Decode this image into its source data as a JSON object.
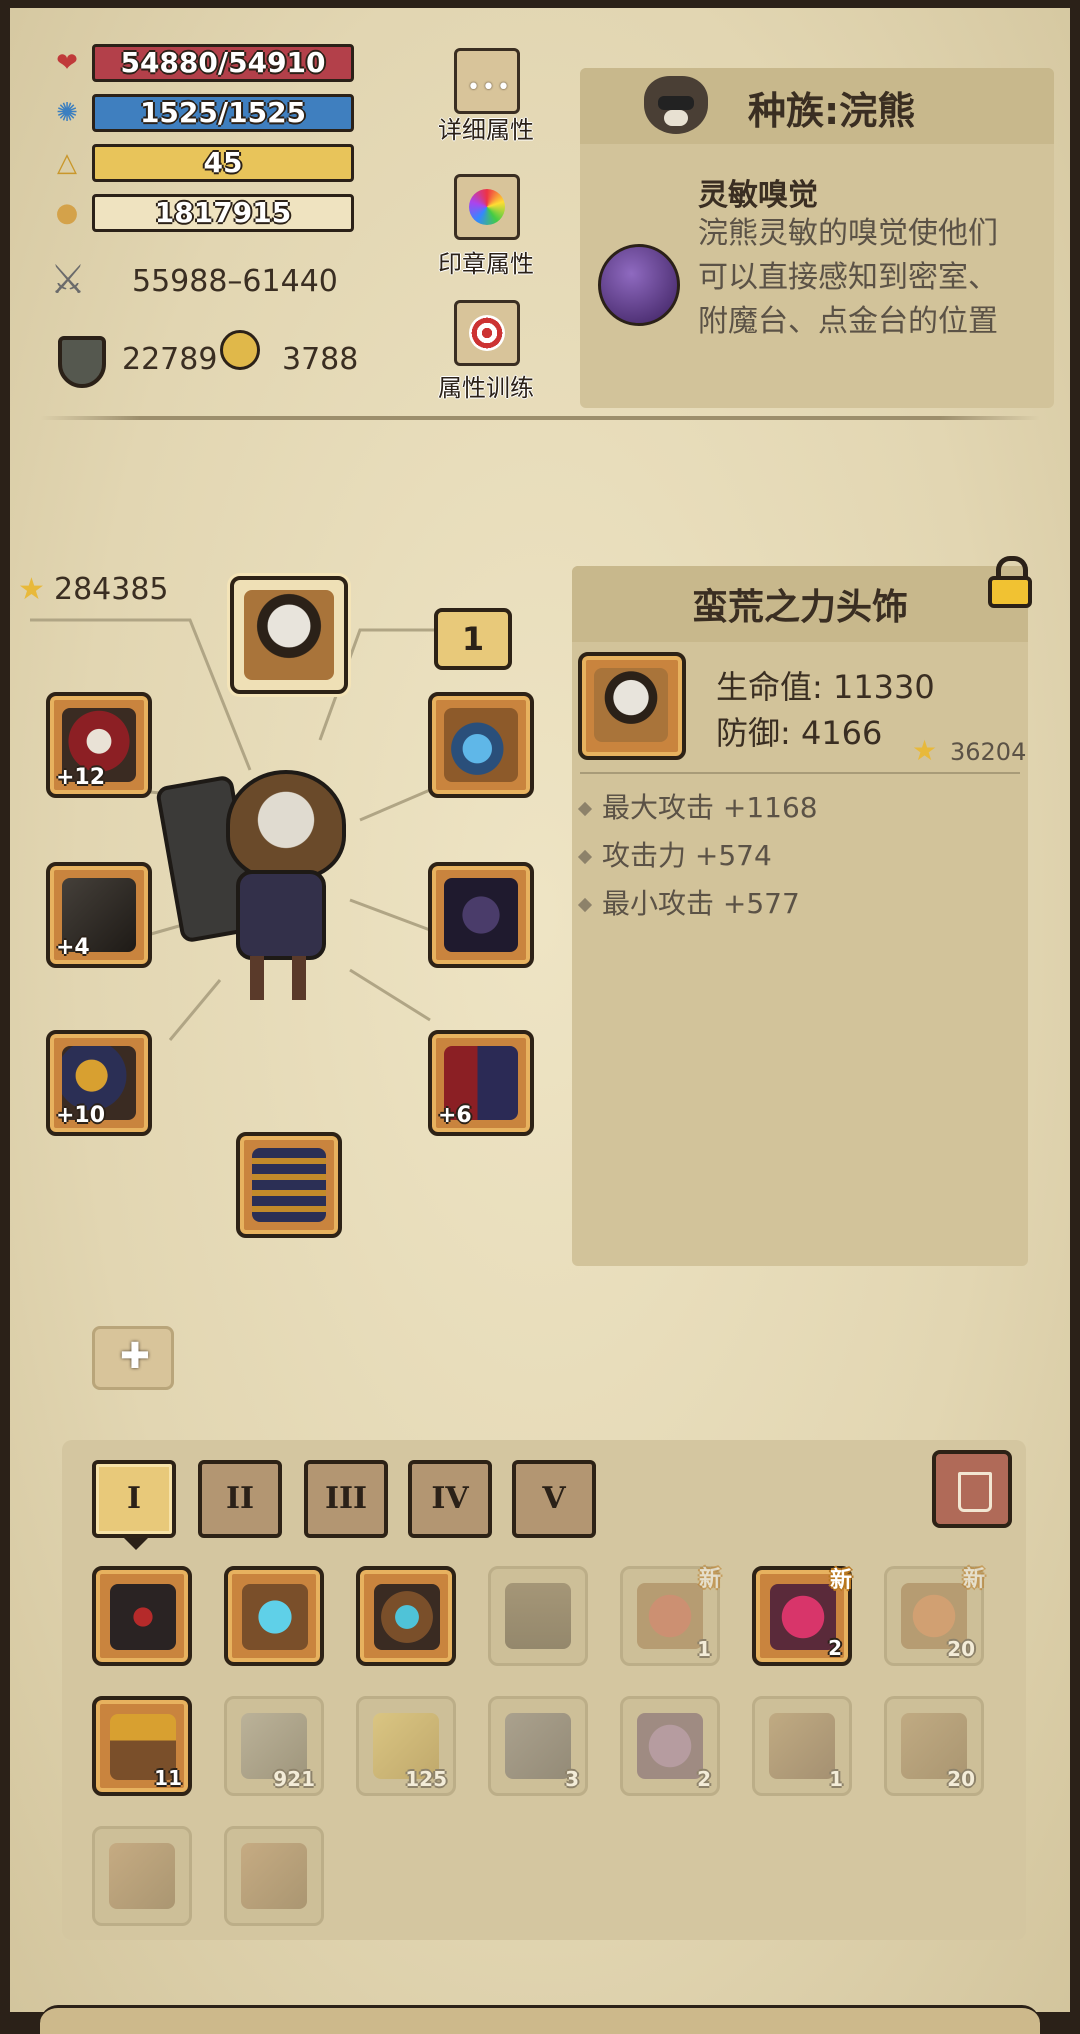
{
  "stats": {
    "hp": "54880/54910",
    "mp": "1525/1525",
    "level": "45",
    "gold": "1817915",
    "attack": "55988–61440",
    "defense": "22789",
    "power": "3788"
  },
  "side_buttons": {
    "detail_label": "详细属性",
    "seal_label": "印章属性",
    "train_label": "属性训练"
  },
  "race_panel": {
    "title": "种族:浣熊",
    "skill_name": "灵敏嗅觉",
    "skill_desc": "浣熊灵敏的嗅觉使他们可以直接感知到密室、附魔台、点金台的位置"
  },
  "equipment": {
    "total_score": "284385",
    "page_badge": "1",
    "weapon_level": "+12",
    "glove_level": "+4",
    "boots_level": "+10",
    "pants_level": "+6"
  },
  "item_panel": {
    "name": "蛮荒之力头饰",
    "hp_line": "生命值: 11330",
    "def_line": "防御: 4166",
    "score": "36204",
    "bonuses": [
      "最大攻击 +1168",
      "攻击力 +574",
      "最小攻击 +577"
    ]
  },
  "tabs": [
    "I",
    "II",
    "III",
    "IV",
    "V"
  ],
  "new_badge": "新",
  "inventory": {
    "row1": [
      {
        "name": "dark-armor",
        "count": "",
        "new": false,
        "dim": false
      },
      {
        "name": "blue-amulet",
        "count": "",
        "new": false,
        "dim": false
      },
      {
        "name": "star-ring",
        "count": "",
        "new": false,
        "dim": false
      },
      {
        "name": "robe",
        "count": "",
        "new": false,
        "dim": true
      },
      {
        "name": "red-potion",
        "count": "1",
        "new": true,
        "dim": true
      },
      {
        "name": "pink-star-potion",
        "count": "2",
        "new": true,
        "dim": false
      },
      {
        "name": "bowl",
        "count": "20",
        "new": true,
        "dim": true
      }
    ],
    "row2": [
      {
        "name": "treasure-chest",
        "count": "11",
        "new": false,
        "dim": false
      },
      {
        "name": "iron-ingot",
        "count": "921",
        "new": false,
        "dim": true
      },
      {
        "name": "gold-crystal",
        "count": "125",
        "new": false,
        "dim": true
      },
      {
        "name": "hook",
        "count": "3",
        "new": false,
        "dim": true
      },
      {
        "name": "purple-pouch",
        "count": "2",
        "new": false,
        "dim": true
      },
      {
        "name": "glove",
        "count": "1",
        "new": false,
        "dim": true
      },
      {
        "name": "wood-log",
        "count": "20",
        "new": false,
        "dim": true
      }
    ],
    "row3": [
      {
        "name": "book",
        "count": "",
        "new": false,
        "dim": true
      },
      {
        "name": "book",
        "count": "",
        "new": false,
        "dim": true
      }
    ]
  },
  "colors": {
    "hp_bar": "#b3404a",
    "mp_bar": "#3f7fbf",
    "level_bar": "#e8c45a",
    "gold_bar": "#efe3c0",
    "slot_border": "#c9843e"
  }
}
